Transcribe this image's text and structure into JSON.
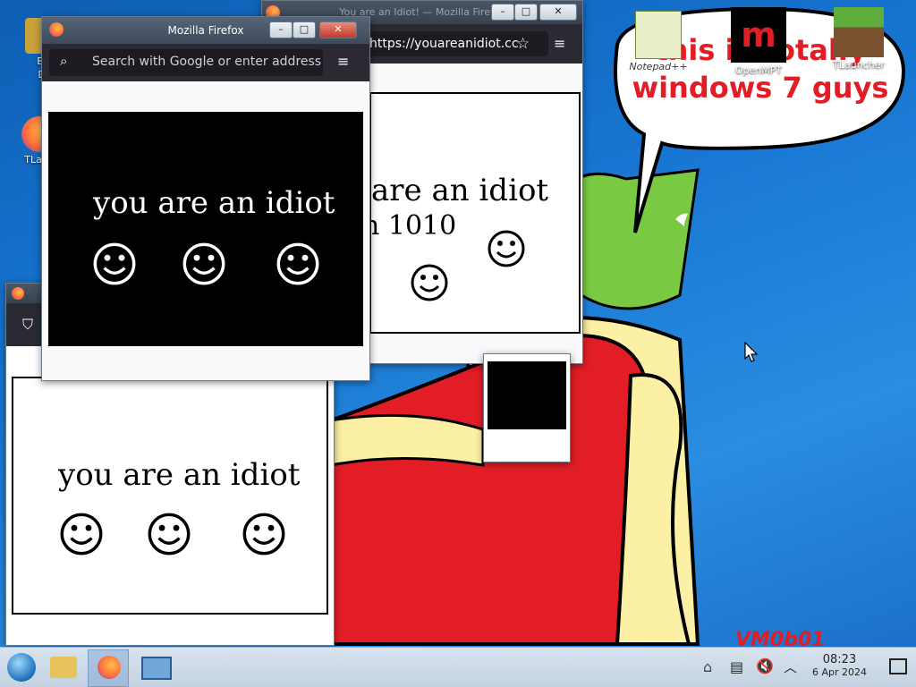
{
  "desktop": {
    "icons": [
      {
        "label": "Big",
        "sub": "De"
      },
      {
        "label": "TLaun"
      },
      {
        "label": "Notepad++"
      },
      {
        "label": "OpenMPT"
      },
      {
        "label": "TLauncher"
      }
    ],
    "bubble_text": "this is totally windows 7 guys",
    "watermark": "VM0b01"
  },
  "windows": {
    "back": {
      "title": "You are an Idiot! — Mozilla Firefox",
      "url": "https://youareanidiot.cc",
      "line1": "are an idiot",
      "line2": "n 1010"
    },
    "front": {
      "title": "Mozilla Firefox",
      "search_placeholder": "Search with Google or enter address",
      "message": "you are an idiot"
    },
    "lower": {
      "message": "you are an idiot"
    }
  },
  "taskbar": {
    "time": "08:23",
    "date": "6 Apr 2024"
  },
  "colors": {
    "desktop_blue": "#1877d3",
    "firefox_toolbar": "#2b2a33",
    "close_red": "#c4392a"
  }
}
